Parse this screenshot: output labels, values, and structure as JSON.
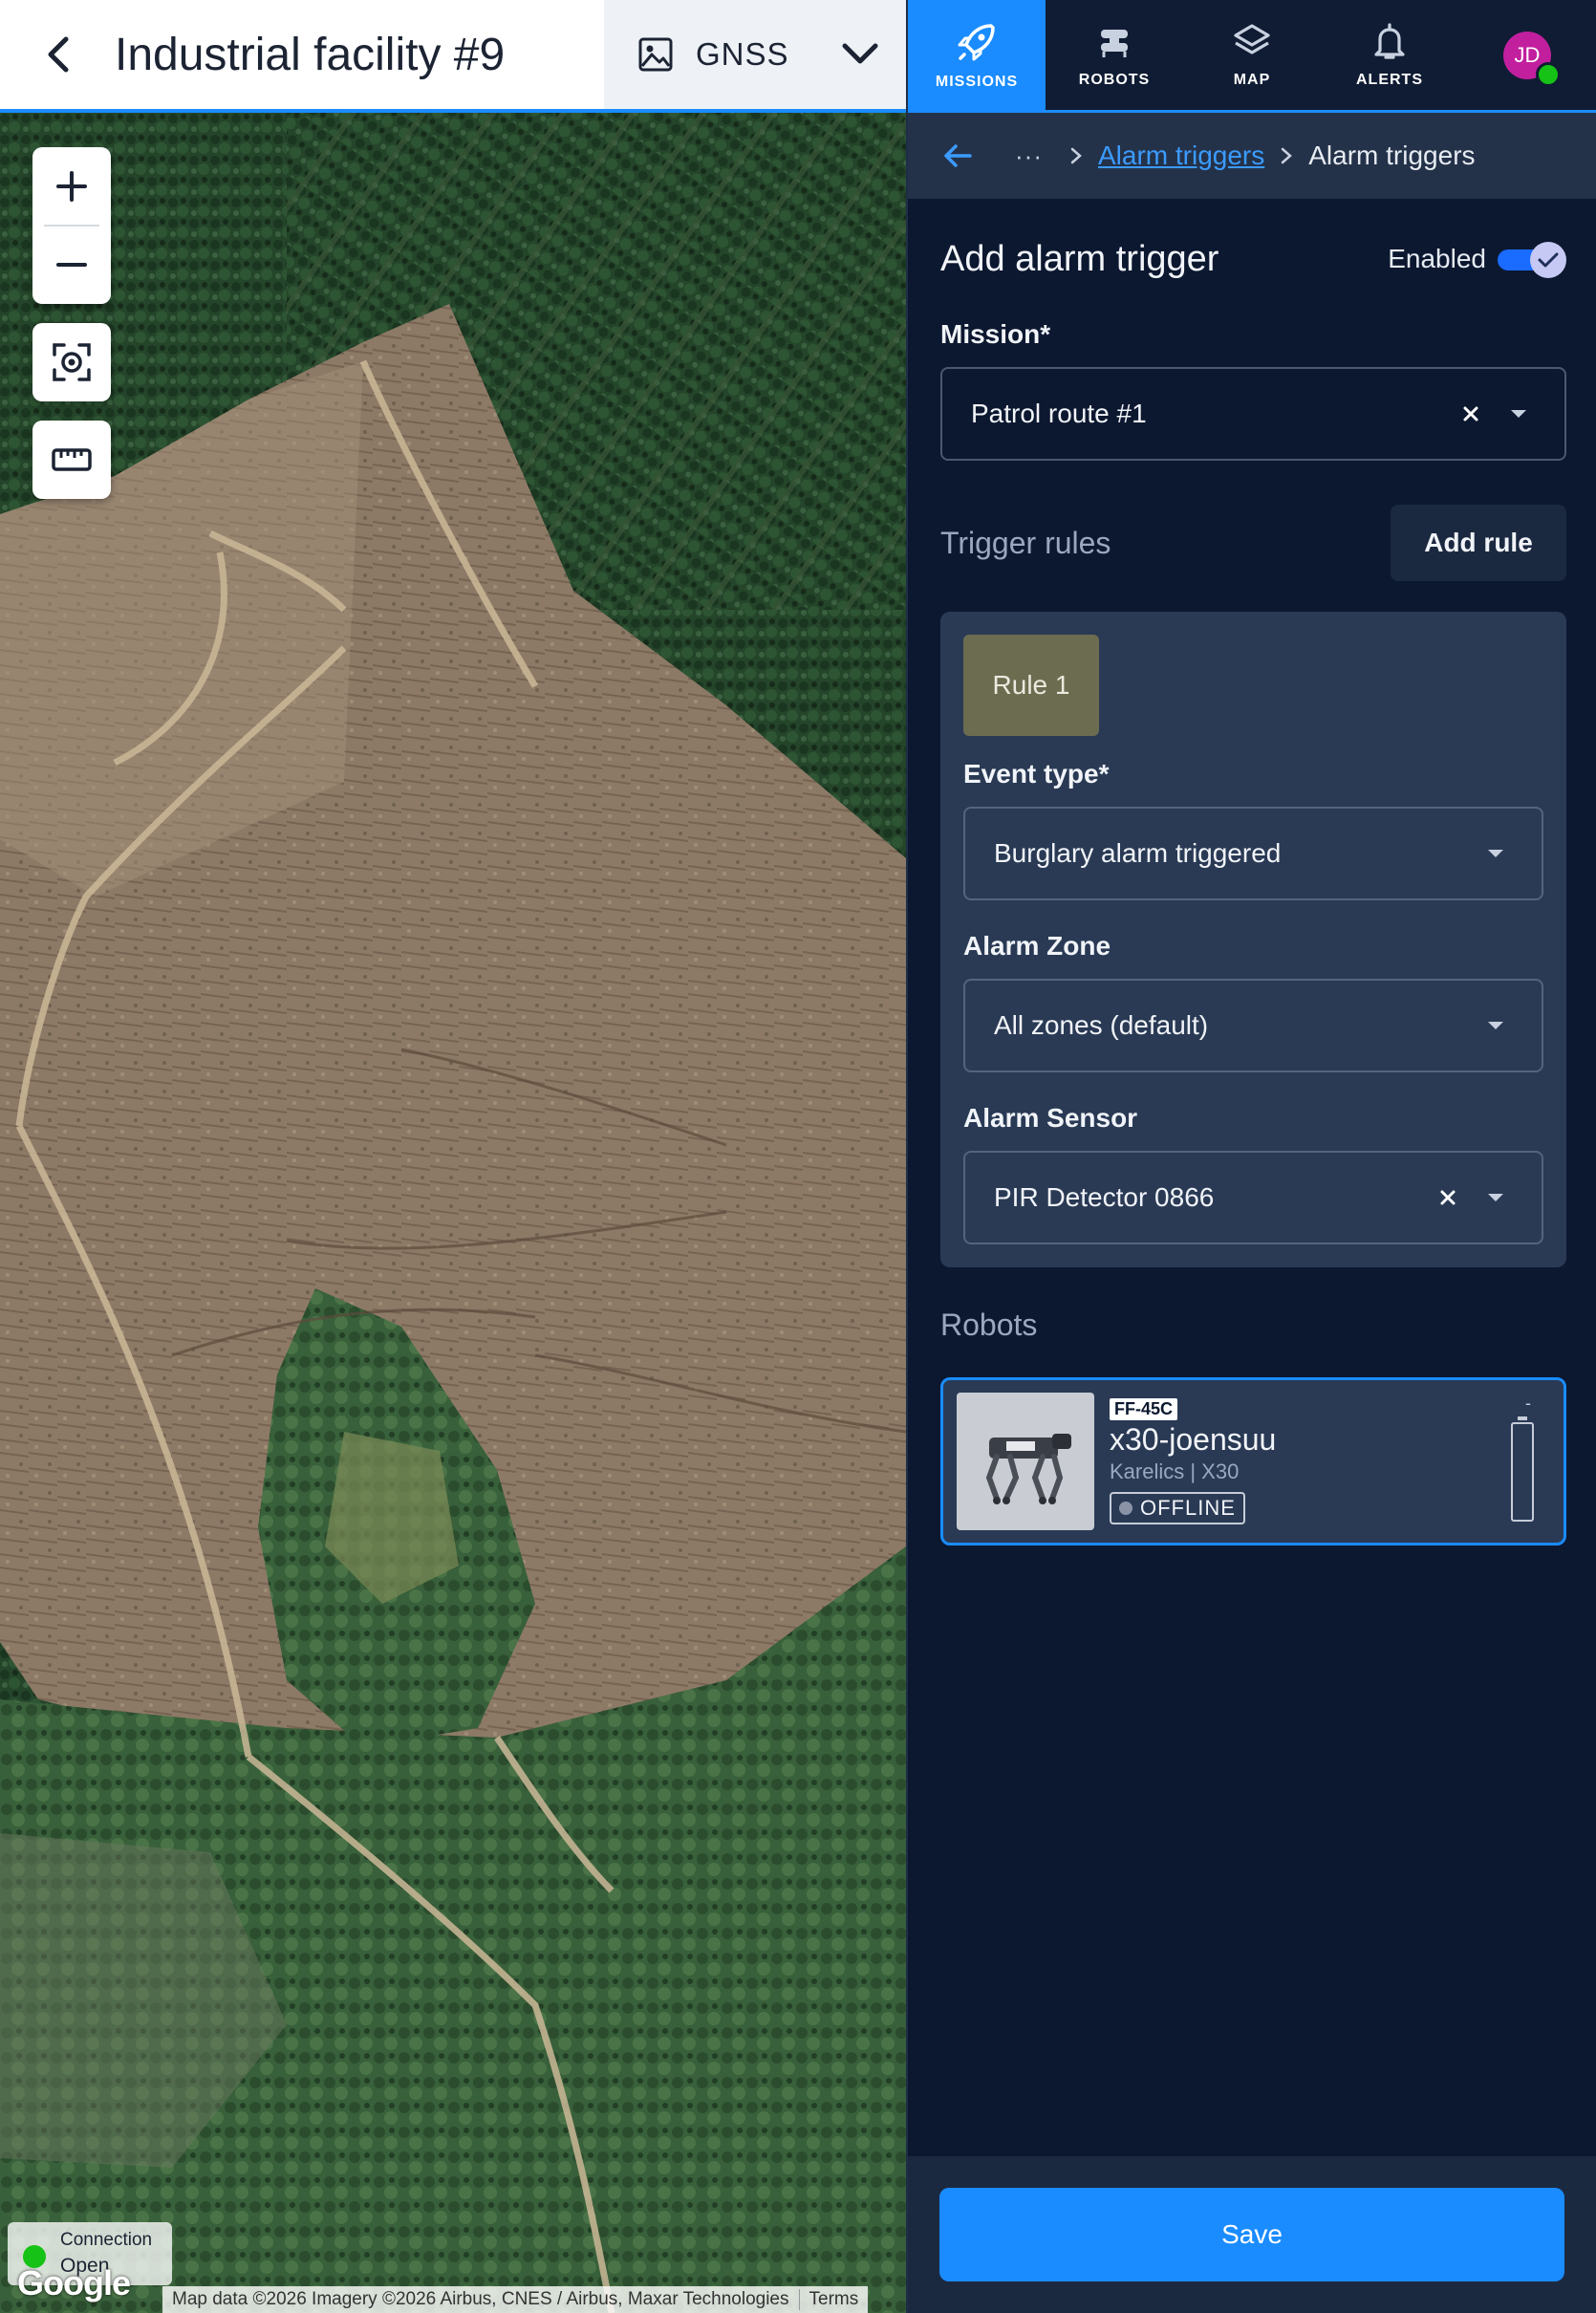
{
  "header": {
    "facility_title": "Industrial facility #9",
    "map_source_label": "GNSS"
  },
  "map": {
    "connection_label": "Connection",
    "connection_status": "Open",
    "provider_logo": "Google",
    "attribution": "Map data ©2026 Imagery ©2026 Airbus, CNES / Airbus, Maxar Technologies",
    "terms": "Terms"
  },
  "nav": {
    "items": [
      {
        "label": "MISSIONS",
        "icon": "rocket-icon",
        "active": true
      },
      {
        "label": "ROBOTS",
        "icon": "robot-icon",
        "active": false
      },
      {
        "label": "MAP",
        "icon": "layers-icon",
        "active": false
      },
      {
        "label": "ALERTS",
        "icon": "bell-icon",
        "active": false
      }
    ],
    "avatar_initials": "JD"
  },
  "breadcrumb": {
    "ellipsis": "···",
    "link": "Alarm triggers",
    "current": "Alarm triggers"
  },
  "form": {
    "title": "Add alarm trigger",
    "enabled_label": "Enabled",
    "enabled": true,
    "mission_label": "Mission*",
    "mission_value": "Patrol route #1",
    "trigger_rules_title": "Trigger rules",
    "add_rule_label": "Add rule",
    "rule": {
      "chip": "Rule 1",
      "event_type_label": "Event type*",
      "event_type_value": "Burglary alarm triggered",
      "zone_label": "Alarm Zone",
      "zone_value": "All zones (default)",
      "sensor_label": "Alarm Sensor",
      "sensor_value": "PIR Detector 0866"
    },
    "robots_title": "Robots",
    "robot": {
      "code": "FF-45C",
      "name": "x30-joensuu",
      "model": "Karelics | X30",
      "status": "OFFLINE",
      "battery_text": "-"
    },
    "save_label": "Save"
  },
  "colors": {
    "accent": "#1a8cff",
    "panel_bg": "#0c1830",
    "card_bg": "#2a3a55",
    "avatar": "#c21f9f",
    "online": "#16c216",
    "rule_chip": "#6c6c50"
  }
}
